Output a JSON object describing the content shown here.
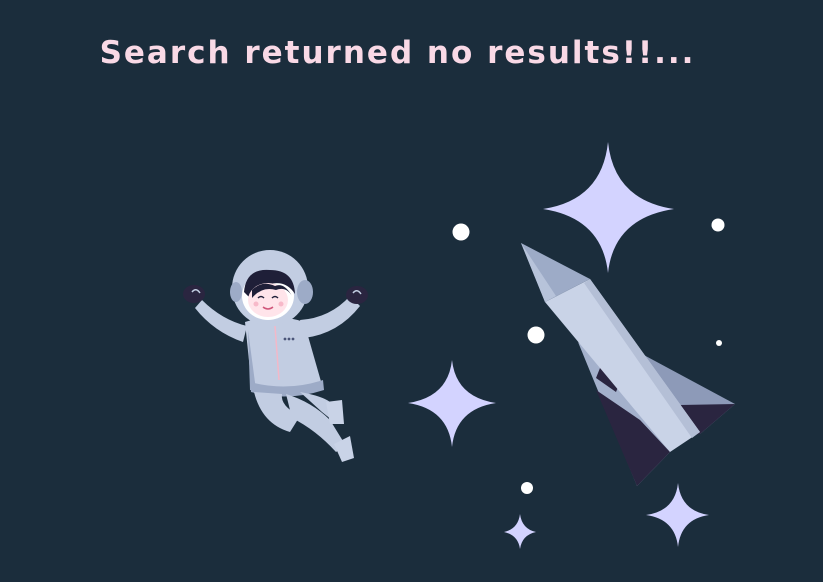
{
  "empty_state": {
    "message": "Search returned no results!!...",
    "illustration": {
      "subject": "astronaut-icon",
      "rocket": "rocket-icon",
      "stars": "sparkle-star-icon",
      "dots": "star-dot-icon"
    }
  },
  "colors": {
    "background": "#1b2d3c",
    "message_text": "#f9d9e6",
    "star": "#d3d3ff",
    "dot": "#ffffff",
    "suit": "#c2cde2",
    "suit_shadow": "#9dabc7",
    "rocket_body": "#c9d3e7",
    "rocket_fin": "#8d9ab8",
    "rocket_dark": "#2a2540"
  }
}
